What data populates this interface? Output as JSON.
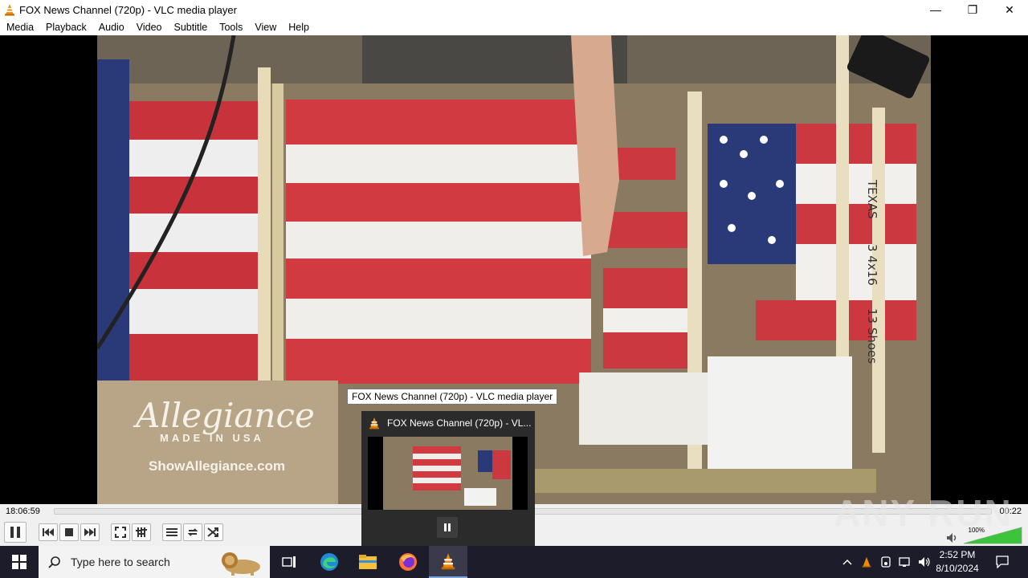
{
  "window": {
    "title": "FOX News Channel (720p) - VLC media player",
    "minimize_glyph": "—",
    "maximize_glyph": "❐",
    "close_glyph": "✕"
  },
  "menu": [
    "Media",
    "Playback",
    "Audio",
    "Video",
    "Subtitle",
    "Tools",
    "View",
    "Help"
  ],
  "video": {
    "overlay_brand": "Allegiance",
    "overlay_made": "MADE IN USA",
    "overlay_url": "ShowAllegiance.com",
    "note_texas": "TEXAS",
    "note_3x16": "3 4x16",
    "note_shoes": "13 Shoes"
  },
  "player": {
    "elapsed": "18:06:59",
    "total": "00:22",
    "seek_position": 0.0,
    "volume_percent": "100%",
    "volume_level": 1.0
  },
  "tooltip": "FOX News Channel (720p) - VLC media player",
  "thumbnail": {
    "title": "FOX News Channel (720p) - VL..."
  },
  "watermark": "ANY RUN",
  "taskbar": {
    "search_placeholder": "Type here to search",
    "time": "2:52 PM",
    "date": "8/10/2024"
  },
  "icons": {
    "app": "vlc-cone-icon",
    "controls": [
      "pause-icon",
      "previous-icon",
      "stop-icon",
      "next-icon",
      "fullscreen-icon",
      "extended-settings-icon",
      "playlist-icon",
      "loop-icon",
      "shuffle-icon",
      "speaker-icon"
    ],
    "taskbar": [
      "windows-start-icon",
      "search-icon",
      "task-view-icon",
      "edge-icon",
      "file-explorer-icon",
      "firefox-icon",
      "vlc-cone-icon"
    ],
    "tray": [
      "chevron-up-icon",
      "vlc-tray-icon",
      "device-icon",
      "network-icon",
      "volume-icon",
      "notification-icon"
    ]
  },
  "colors": {
    "vlc_orange": "#f28a00",
    "volume_green": "#3cc43c",
    "taskbar_bg": "#1c1c2b"
  }
}
